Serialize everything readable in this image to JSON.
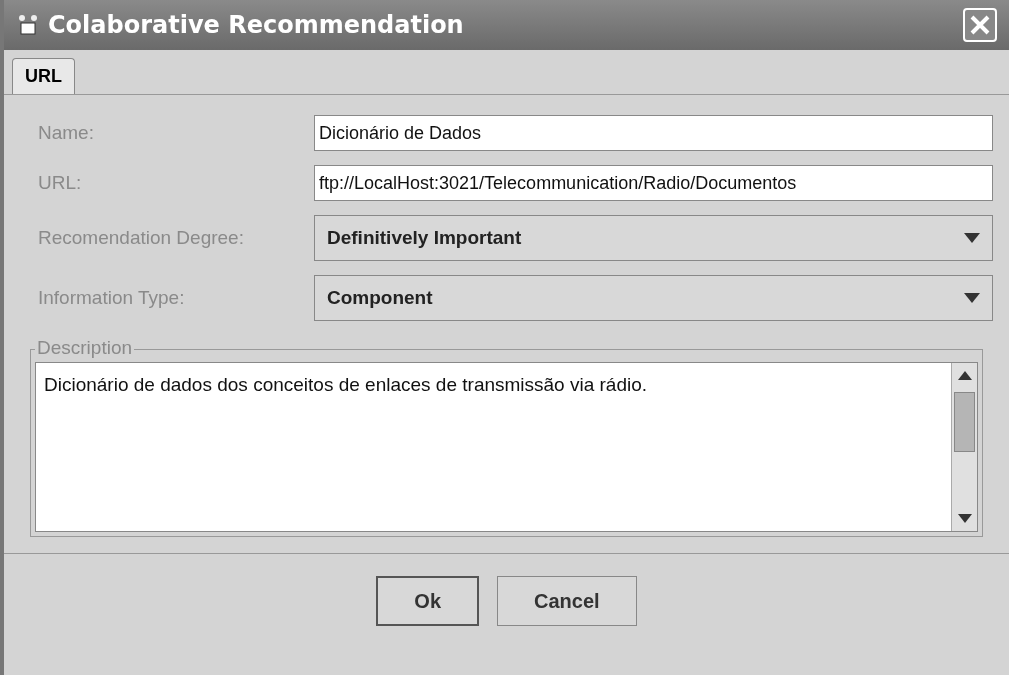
{
  "window": {
    "title": "Colaborative Recommendation"
  },
  "tabs": [
    {
      "label": "URL",
      "selected": true
    }
  ],
  "fields": [
    {
      "kind": "text",
      "label": "Name:",
      "value": "Dicionário de Dados"
    },
    {
      "kind": "text",
      "label": "URL:",
      "value": "ftp://LocalHost:3021/Telecommunication/Radio/Documentos"
    },
    {
      "kind": "select",
      "label": "Recomendation Degree:",
      "value": "Definitively Important"
    },
    {
      "kind": "select",
      "label": "Information Type:",
      "value": "Component"
    }
  ],
  "description": {
    "title": "Description",
    "value": "Dicionário de dados dos conceitos de enlaces de transmissão via rádio."
  },
  "buttons": [
    {
      "label": "Ok",
      "selected": true
    },
    {
      "label": "Cancel",
      "selected": false
    }
  ]
}
